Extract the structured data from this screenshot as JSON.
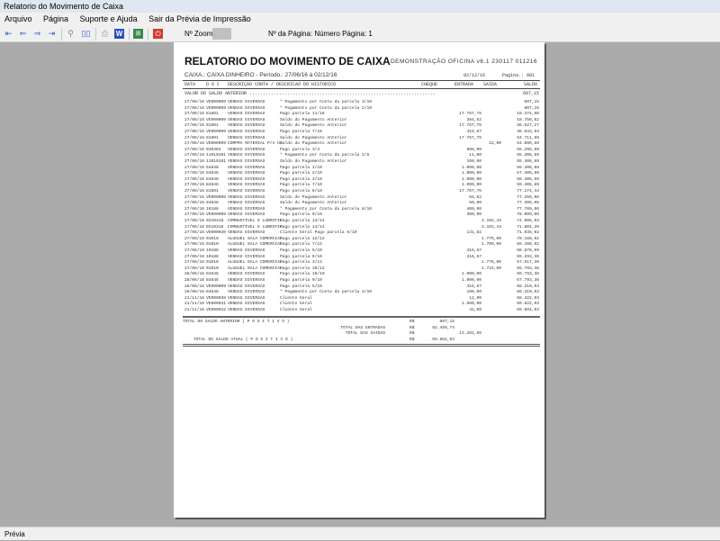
{
  "window": {
    "title": "Relatorio do Movimento de Caixa"
  },
  "menu": [
    "Arquivo",
    "Página",
    "Suporte e Ajuda",
    "Sair da Prévia de Impressão"
  ],
  "toolbar": {
    "zoom_label": "Nº Zoom",
    "page_label": "Nº da Página: Número Página: 1"
  },
  "report": {
    "title": "RELATORIO DO MOVIMENTO DE CAIXA",
    "system": "DEMONSTRAÇÃO OFICINA v6.1 230117 011216",
    "subtitle": "CAIXA.: CAIXA DINHEIRO -  Período.: 27/06/16 à 02/12/16",
    "date": "02/12/16",
    "page": "Pagina.: 001",
    "headers": {
      "data": "DATA",
      "doc": "D O C",
      "desc": "DESCRIÇÃO CONTA / DESCRICAO DO HISTORICO",
      "cheque": "CHEQUE",
      "entrada": "ENTRADA",
      "saida": "SAIDA",
      "saldo": "SALDO"
    },
    "previous_label": "VALOR DO SALDO ANTERIOR .....................................................................",
    "previous_value": "607,15",
    "rows": [
      [
        "27/06/16",
        "VE000009",
        "VENDAS DIVERSAS",
        "* Pagamento por Conta da parcela 3/10",
        "",
        "",
        "607,15"
      ],
      [
        "27/06/16",
        "VE000009",
        "VENDAS DIVERSAS",
        "* Pagamento por Conta da parcela 2/10",
        "",
        "",
        "607,15"
      ],
      [
        "27/06/16",
        "81801",
        "VENDAS DIVERSAS",
        "Pago parcela 11/18",
        "17.767,75",
        "",
        "18.374,90"
      ],
      [
        "27/06/16",
        "VE000009",
        "VENDAS DIVERSAS",
        "Saldo do Pagamento Anterior",
        "384,62",
        "",
        "18.759,52"
      ],
      [
        "27/06/16",
        "81801",
        "VENDAS DIVERSAS",
        "Saldo do Pagamento Anterior",
        "17.767,75",
        "",
        "36.527,27"
      ],
      [
        "27/06/16",
        "VE000009",
        "VENDAS DIVERSAS",
        "Pago parcela 7/18",
        "416,67",
        "",
        "36.943,94"
      ],
      [
        "27/06/16",
        "81801",
        "VENDAS DIVERSAS",
        "Saldo do Pagamento Anterior",
        "17.767,75",
        "",
        "54.711,69"
      ],
      [
        "27/06/16",
        "VE000009",
        "COMPRA MATERIAL P/A US",
        "Saldo do Pagamento Anterior",
        "",
        "22,00",
        "54.689,69"
      ],
      [
        "27/06/16",
        "030303",
        "VENDAS DIVERSAS",
        "Pago parcela 3/4",
        "606,00",
        "",
        "55.295,69"
      ],
      [
        "27/06/16",
        "11010101",
        "VENDAS DIVERSAS",
        "* Pagamento por Conta da parcela 1/5",
        "11,00",
        "",
        "55.306,69"
      ],
      [
        "27/06/16",
        "11010101",
        "VENDAS DIVERSAS",
        "Saldo do Pagamento Anterior",
        "100,00",
        "",
        "55.406,69"
      ],
      [
        "27/06/16",
        "84848",
        "VENDAS DIVERSAS",
        "Pago parcela 1/10",
        "1.000,00",
        "",
        "56.406,69"
      ],
      [
        "27/06/16",
        "84848",
        "VENDAS DIVERSAS",
        "Pago parcela 2/10",
        "1.000,00",
        "",
        "57.406,69"
      ],
      [
        "27/06/16",
        "84848",
        "VENDAS DIVERSAS",
        "Pago parcela 3/10",
        "1.000,00",
        "",
        "58.406,69"
      ],
      [
        "27/06/16",
        "84848",
        "VENDAS DIVERSAS",
        "Pago parcela 7/10",
        "1.000,00",
        "",
        "59.406,69"
      ],
      [
        "27/06/16",
        "81801",
        "VENDAS DIVERSAS",
        "Pago parcela 6/18",
        "17.767,75",
        "",
        "77.174,44"
      ],
      [
        "27/06/16",
        "VE000008",
        "VENDAS DIVERSAS",
        "Saldo do Pagamento Anterior",
        "84,62",
        "",
        "77.259,06"
      ],
      [
        "27/06/16",
        "84848",
        "VENDAS DIVERSAS",
        "Saldo do Pagamento Anterior",
        "50,00",
        "",
        "77.309,06"
      ],
      [
        "27/06/16",
        "10188",
        "VENDAS DIVERSAS",
        "* Pagamento por Conta da parcela 8/10",
        "400,00",
        "",
        "77.709,06"
      ],
      [
        "27/06/16",
        "VE000008",
        "VENDAS DIVERSAS",
        "Pago parcela 9/18",
        "300,00",
        "",
        "78.009,06"
      ],
      [
        "27/06/16",
        "0310318",
        "COMBUSTÍVEL E LUBRIFIC",
        "Pago parcela 13/14",
        "",
        "3.102,43",
        "74.906,63"
      ],
      [
        "27/06/16",
        "0310318",
        "COMBUSTÍVEL E LUBRIFIC",
        "Pago parcela 14/14",
        "",
        "3.102,43",
        "71.804,20"
      ],
      [
        "27/06/16",
        "VE000030",
        "VENDAS DIVERSAS",
        "Cliente Geral Pago parcela 6/10",
        "131,82",
        "",
        "71.936,02"
      ],
      [
        "27/06/16",
        "01010",
        "ALUGUEL SALA COMERCIAL",
        "Pago parcela 12/12",
        "",
        "1.776,00",
        "70.160,02"
      ],
      [
        "27/06/16",
        "01010",
        "ALUGUEL SALA COMERCIAL",
        "Pago parcela 7/12",
        "",
        "1.700,00",
        "68.460,02"
      ],
      [
        "27/06/16",
        "10188",
        "VENDAS DIVERSAS",
        "Pago parcela 5/10",
        "416,67",
        "",
        "68.876,69"
      ],
      [
        "27/06/16",
        "10188",
        "VENDAS DIVERSAS",
        "Pago parcela 6/10",
        "416,67",
        "",
        "69.293,36"
      ],
      [
        "27/06/16",
        "01010",
        "ALUGUEL SALA COMERCIAL",
        "Pago parcela 3/12",
        "",
        "1.776,00",
        "67.517,36"
      ],
      [
        "27/06/16",
        "01010",
        "ALUGUEL SALA COMERCIAL",
        "Pago parcela 10/12",
        "",
        "1.724,00",
        "65.793,36"
      ],
      [
        "28/06/16",
        "84848",
        "VENDAS DIVERSAS",
        "Pago parcela 10/10",
        "1.000,00",
        "",
        "66.793,36"
      ],
      [
        "28/06/16",
        "84848",
        "VENDAS DIVERSAS",
        "Pago parcela 9/10",
        "1.000,00",
        "",
        "67.793,36"
      ],
      [
        "28/06/16",
        "VE000009",
        "VENDAS DIVERSAS",
        "Pago parcela 5/10",
        "416,67",
        "",
        "68.210,03"
      ],
      [
        "28/06/16",
        "84848",
        "VENDAS DIVERSAS",
        "* Pagamento por Conta da parcela 4/10",
        "100,00",
        "",
        "68.310,03"
      ],
      [
        "21/11/16",
        "VE000038",
        "VENDAS DIVERSAS",
        "Cliente Geral",
        "12,00",
        "",
        "68.322,03"
      ],
      [
        "21/11/16",
        "VE000041",
        "VENDAS DIVERSAS",
        "Cliente Geral",
        "1.500,00",
        "",
        "69.822,03"
      ],
      [
        "21/11/16",
        "VE000042",
        "VENDAS DIVERSAS",
        "Cliente Geral",
        "42,00",
        "",
        "69.864,03"
      ]
    ],
    "totals": [
      {
        "label": "TOTAL DO SALDO ANTERIOR ( P O S I T I V O )",
        "currency": "R$",
        "value": "607,15",
        "col": "a"
      },
      {
        "label": "TOTAL DAS ENTRADAS",
        "currency": "R$",
        "value": "82.459,74",
        "col": "a"
      },
      {
        "label": "TOTAL DAS SAIDAS",
        "currency": "R$",
        "value": "13.202,86",
        "col": "b"
      },
      {
        "label": "TOTAL DO SALDO ATUAL ( P O S I T I V O )",
        "currency": "R$",
        "value": "69.864,03",
        "col": "a"
      }
    ]
  },
  "status": {
    "text": "Prévia"
  }
}
